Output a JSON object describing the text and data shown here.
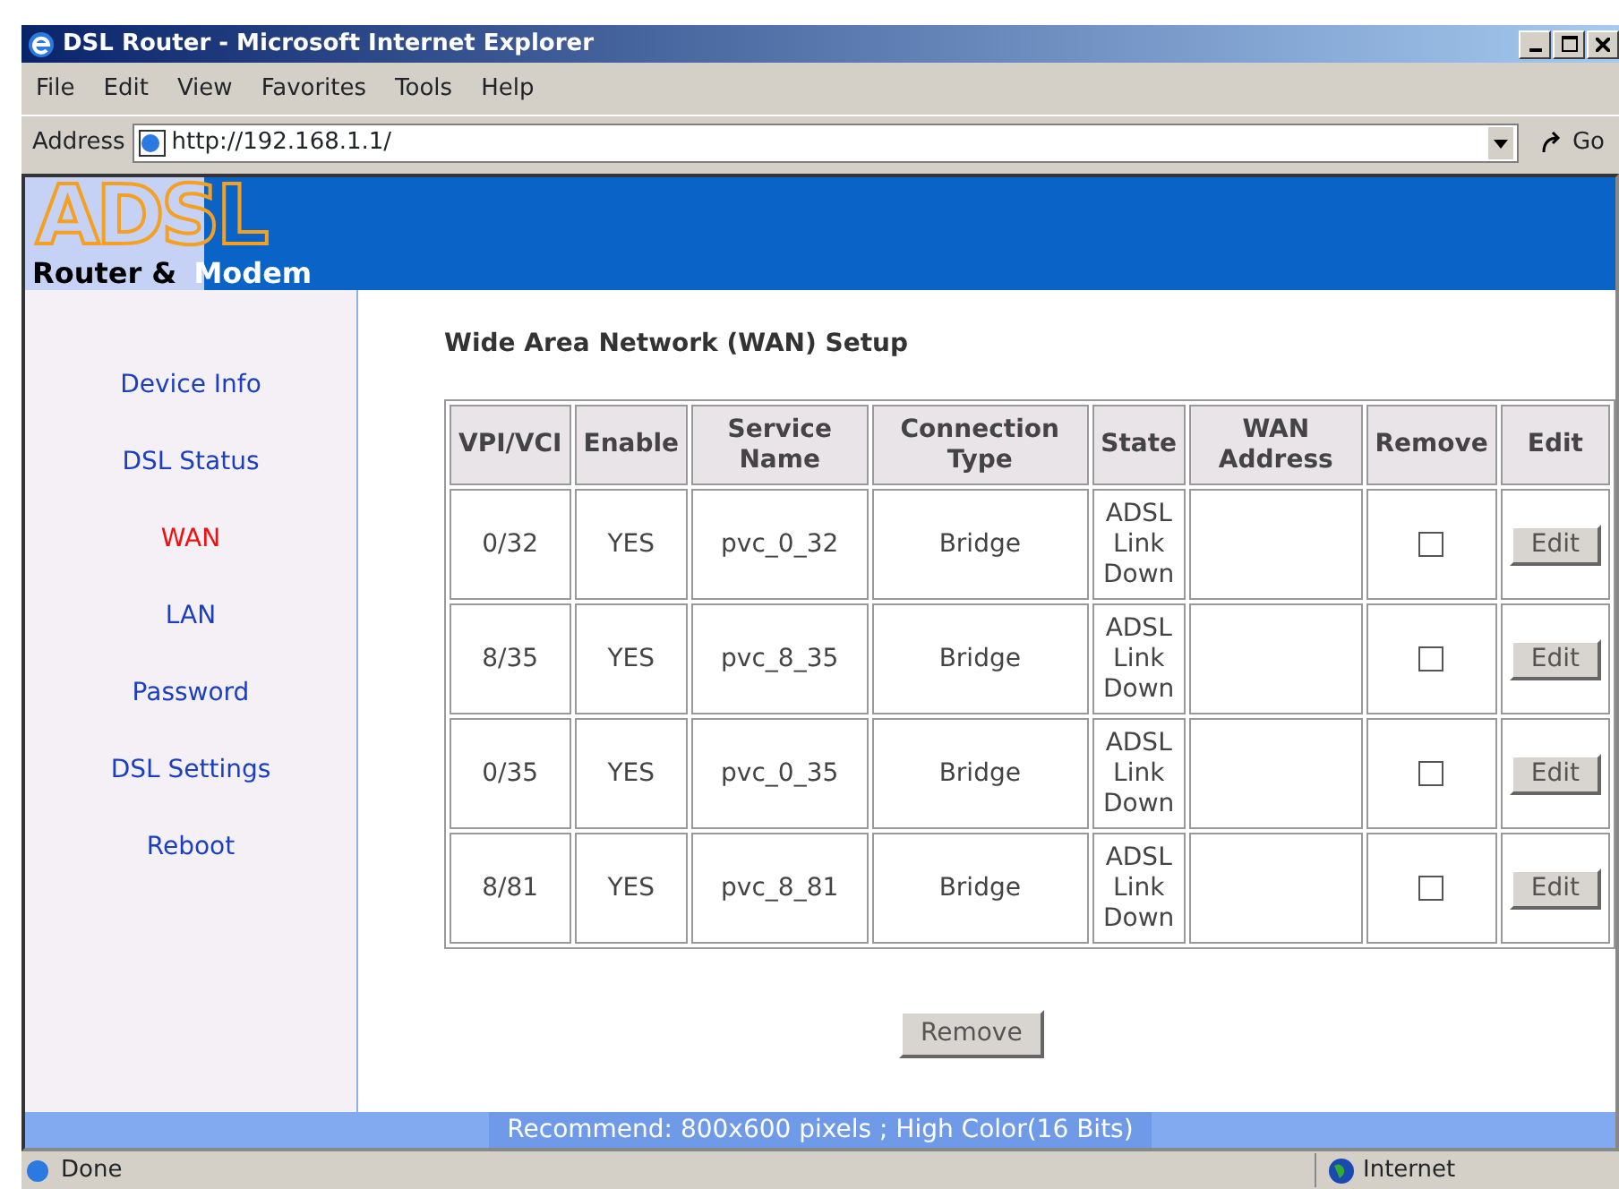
{
  "window": {
    "title": "DSL Router - Microsoft Internet Explorer"
  },
  "menu": [
    "File",
    "Edit",
    "View",
    "Favorites",
    "Tools",
    "Help"
  ],
  "address_bar": {
    "label": "Address",
    "value": "http://192.168.1.1/",
    "go": "Go"
  },
  "banner": {
    "logo": "ADSL",
    "tagline_1": "Router &",
    "tagline_2": "Modem"
  },
  "sidebar": {
    "items": [
      {
        "label": "Device Info",
        "selected": false
      },
      {
        "label": "DSL Status",
        "selected": false
      },
      {
        "label": "WAN",
        "selected": true
      },
      {
        "label": "LAN",
        "selected": false
      },
      {
        "label": "Password",
        "selected": false
      },
      {
        "label": "DSL Settings",
        "selected": false
      },
      {
        "label": "Reboot",
        "selected": false
      }
    ]
  },
  "page_title": "Wide Area Network (WAN) Setup",
  "table": {
    "columns": [
      "VPI/VCI",
      "Enable",
      "Service Name",
      "Connection Type",
      "State",
      "WAN Address",
      "Remove",
      "Edit"
    ],
    "rows": [
      {
        "vpi_vci": "0/32",
        "enable": "YES",
        "service_name": "pvc_0_32",
        "connection_type": "Bridge",
        "state": "ADSL Link Down",
        "remove": false,
        "edit": "Edit"
      },
      {
        "vpi_vci": "8/35",
        "enable": "YES",
        "service_name": "pvc_8_35",
        "connection_type": "Bridge",
        "state": "ADSL Link Down",
        "remove": false,
        "edit": "Edit"
      },
      {
        "vpi_vci": "0/35",
        "enable": "YES",
        "service_name": "pvc_0_35",
        "connection_type": "Bridge",
        "state": "ADSL Link Down",
        "remove": false,
        "edit": "Edit"
      },
      {
        "vpi_vci": "8/81",
        "enable": "YES",
        "service_name": "pvc_8_81",
        "connection_type": "Bridge",
        "state": "ADSL Link Down",
        "remove": false,
        "edit": "Edit"
      }
    ]
  },
  "remove_button": "Remove",
  "footer_note": "Recommend: 800x600 pixels ; High Color(16 Bits)",
  "status_bar": {
    "text": "Done",
    "zone": "Internet"
  }
}
